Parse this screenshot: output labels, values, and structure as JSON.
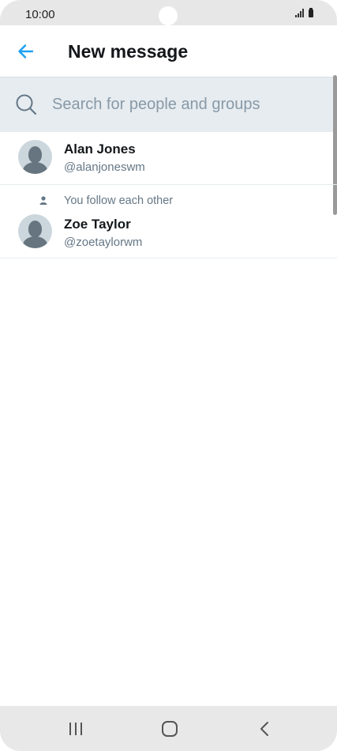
{
  "status_bar": {
    "time": "10:00"
  },
  "header": {
    "back_icon": "arrow-left-icon",
    "title": "New message",
    "accent_color": "#1da1f2"
  },
  "search": {
    "icon": "search-icon",
    "placeholder": "Search for people and groups",
    "value": ""
  },
  "contacts": [
    {
      "name": "Alan Jones",
      "handle": "@alanjoneswm",
      "avatar_icon": "default-avatar-icon"
    },
    {
      "social_context_icon": "person-icon",
      "social_context": "You follow each other",
      "name": "Zoe Taylor",
      "handle": "@zoetaylorwm",
      "avatar_icon": "default-avatar-icon"
    }
  ],
  "nav_bar": {
    "recents_icon": "recent-apps-icon",
    "home_icon": "home-icon",
    "back_icon": "back-chevron-icon"
  }
}
